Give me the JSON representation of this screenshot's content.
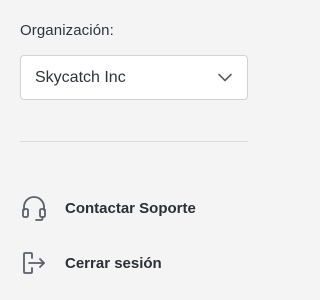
{
  "organization": {
    "label": "Organización:",
    "selected": "Skycatch Inc",
    "dropdown_icon": "chevron-down-icon"
  },
  "menu": {
    "items": [
      {
        "label": "Contactar Soporte",
        "icon": "headset-icon"
      },
      {
        "label": "Cerrar sesión",
        "icon": "logout-icon"
      }
    ]
  },
  "colors": {
    "background": "#f4f4f5",
    "text": "#2b2f36",
    "border": "#cfd2d6",
    "icon": "#5a6069"
  }
}
